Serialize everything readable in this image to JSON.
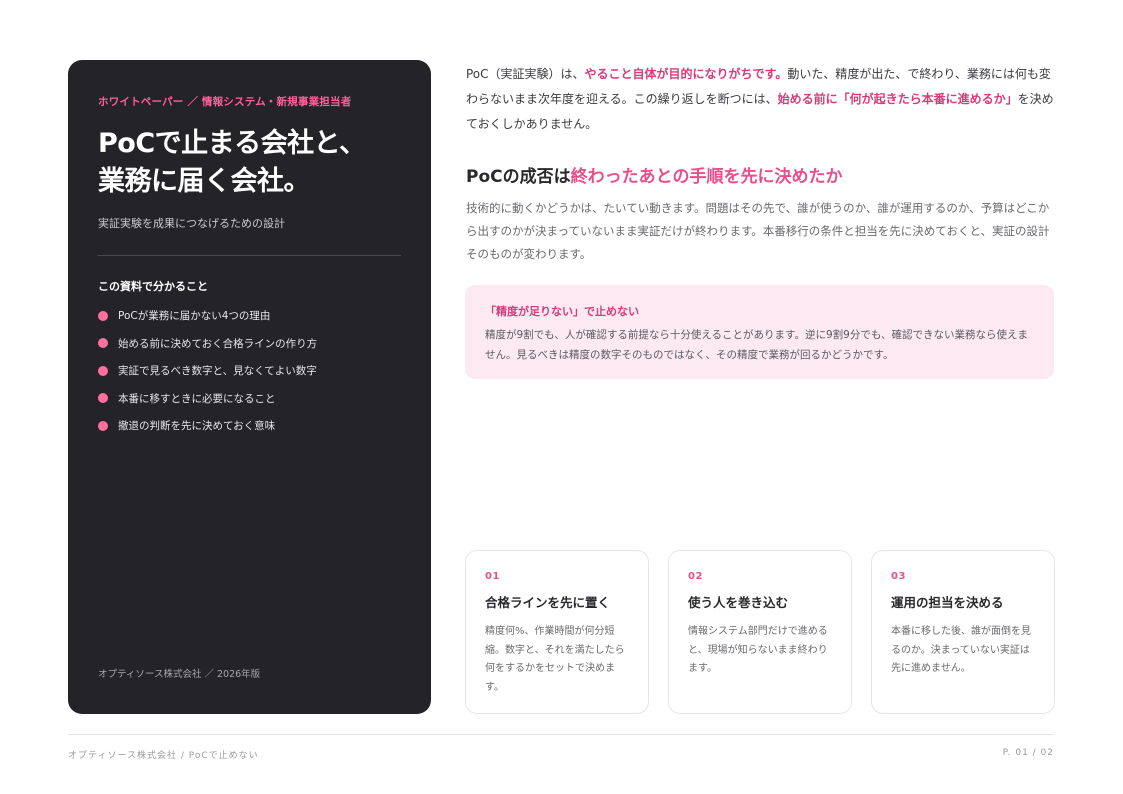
{
  "panel": {
    "eyebrow": "ホワイトペーパー ／ 情報システム・新規事業担当者",
    "title_line1": "PoCで止まる会社と、",
    "title_line2": "業務に届く会社。",
    "subtitle": "実証実験を成果につなげるための設計",
    "learn_heading": "この資料で分かること",
    "learn_items": [
      "PoCが業務に届かない4つの理由",
      "始める前に決めておく合格ラインの作り方",
      "実証で見るべき数字と、見なくてよい数字",
      "本番に移すときに必要になること",
      "撤退の判断を先に決めておく意味"
    ],
    "footer": "オプティソース株式会社 ／ 2026年版"
  },
  "intro": {
    "part1": "PoC（実証実験）は、",
    "hl1": "やること自体が目的になりがちです。",
    "part2": "動いた、精度が出た、で終わり、業務には何も変わらないまま次年度を迎える。この繰り返しを断つには、",
    "hl2": "始める前に「何が起きたら本番に進めるか」",
    "part3": "を決めておくしかありません。"
  },
  "section": {
    "heading_plain": "PoCの成否は",
    "heading_accent": "終わったあとの手順を先に決めたか",
    "body": "技術的に動くかどうかは、たいてい動きます。問題はその先で、誰が使うのか、誰が運用するのか、予算はどこから出すのかが決まっていないまま実証だけが終わります。本番移行の条件と担当を先に決めておくと、実証の設計そのものが変わります。"
  },
  "callout": {
    "heading": "「精度が足りない」で止めない",
    "body": "精度が9割でも、人が確認する前提なら十分使えることがあります。逆に9割9分でも、確認できない業務なら使えません。見るべきは精度の数字そのものではなく、その精度で業務が回るかどうかです。"
  },
  "cards": [
    {
      "num": "01",
      "title": "合格ラインを先に置く",
      "body": "精度何%、作業時間が何分短縮。数字と、それを満たしたら何をするかをセットで決めます。"
    },
    {
      "num": "02",
      "title": "使う人を巻き込む",
      "body": "情報システム部門だけで進めると、現場が知らないまま終わります。"
    },
    {
      "num": "03",
      "title": "運用の担当を決める",
      "body": "本番に移した後、誰が面倒を見るのか。決まっていない実証は先に進めません。"
    }
  ],
  "footer": {
    "left": "オプティソース株式会社 / PoCで止めない",
    "right": "P. 01 / 02"
  },
  "colors": {
    "accent": "#e8508c",
    "panel": "#242327",
    "callout_bg": "#fde9f1"
  }
}
